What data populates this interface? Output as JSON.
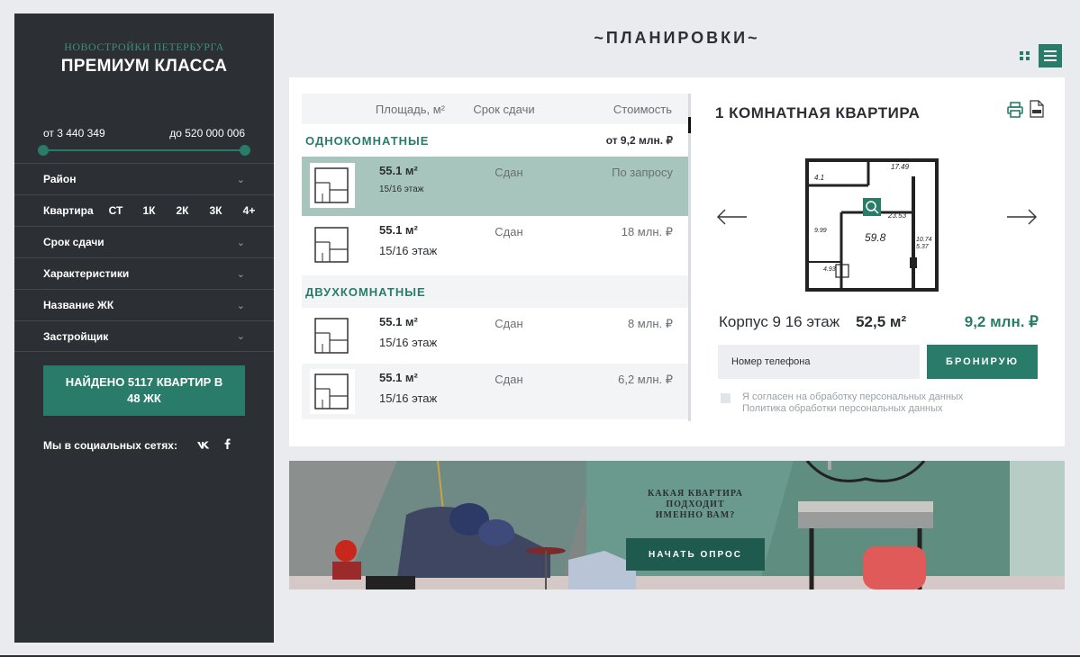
{
  "sidebar": {
    "brand_sub": "НОВОСТРОЙКИ ПЕТЕРБУРГА",
    "brand_main": "ПРЕМИУМ КЛАССА",
    "price_from": "от 3 440 349",
    "price_to": "до 520 000 006",
    "filters": {
      "district": "Район",
      "apartment": "Квартира",
      "room_options": [
        "СТ",
        "1К",
        "2К",
        "3К",
        "4+"
      ],
      "deadline": "Срок сдачи",
      "characteristics": "Характеристики",
      "complex_name": "Название ЖК",
      "developer": "Застройщик"
    },
    "found_button": "НАЙДЕНО 5117 КВАРТИР В 48 ЖК",
    "social_label": "Мы в социальных сетях:",
    "social_vk": "vk",
    "social_fb": "f"
  },
  "main": {
    "title": "~ПЛАНИРОВКИ~"
  },
  "table": {
    "headers": {
      "area": "Площадь, м²",
      "term": "Срок сдачи",
      "price": "Стоимость"
    },
    "groups": [
      {
        "name": "ОДНОКОМНАТНЫЕ",
        "price_from": "от 9,2 млн. ₽",
        "rows": [
          {
            "area": "55.1 м²",
            "floor": "15/16 этаж",
            "term": "Сдан",
            "price": "По запросу"
          },
          {
            "area": "55.1 м²",
            "floor": "15/16 этаж",
            "term": "Сдан",
            "price": "18 млн. ₽"
          }
        ]
      },
      {
        "name": "ДВУХКОМНАТНЫЕ",
        "price_from": "",
        "rows": [
          {
            "area": "55.1 м²",
            "floor": "15/16 этаж",
            "term": "Сдан",
            "price": "8 млн. ₽"
          },
          {
            "area": "55.1 м²",
            "floor": "15/16 этаж",
            "term": "Сдан",
            "price": "6,2 млн. ₽"
          }
        ]
      }
    ]
  },
  "detail": {
    "title": "1 КОМНАТНАЯ КВАРТИРА",
    "plan_labels": {
      "a": "17.49",
      "b": "4.1",
      "c": "23.53",
      "d": "9.99",
      "e": "59.8",
      "f": "10.74",
      "g": "5.37",
      "h": "4.93"
    },
    "corpus": "Корпус 9 16 этаж",
    "area": "52,5 м²",
    "price": "9,2 млн. ₽",
    "phone_placeholder": "Номер телефона",
    "book_button": "БРОНИРУЮ",
    "consent_line1": "Я согласен на обработку персональных данных",
    "consent_line2": "Политика обработки персональных данных"
  },
  "banner": {
    "line1": "КАКАЯ КВАРТИРА",
    "line2": "ПОДХОДИТ",
    "line3": "ИМЕННО ВАМ?",
    "button": "НАЧАТЬ ОПРОС"
  },
  "colors": {
    "accent": "#2a7c6a",
    "sidebar": "#2c2f33",
    "selected_row": "#a8c5bd"
  }
}
